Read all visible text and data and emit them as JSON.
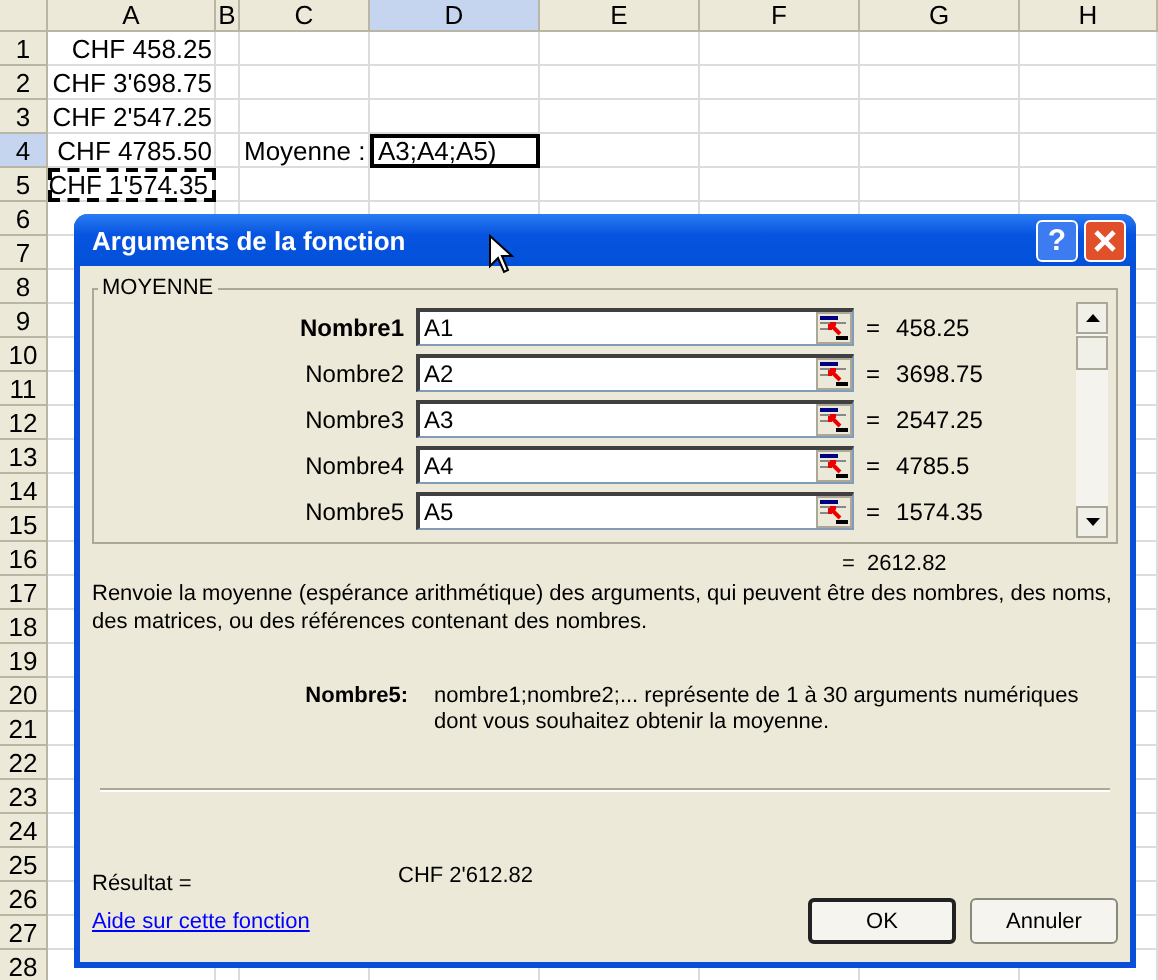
{
  "sheet": {
    "columns": [
      {
        "label": "A",
        "selected": false
      },
      {
        "label": "B",
        "selected": false
      },
      {
        "label": "C",
        "selected": false
      },
      {
        "label": "D",
        "selected": true
      },
      {
        "label": "E",
        "selected": false
      },
      {
        "label": "F",
        "selected": false
      },
      {
        "label": "G",
        "selected": false
      },
      {
        "label": "H",
        "selected": false
      }
    ],
    "rows": [
      {
        "label": "1",
        "selected": false,
        "a": "CHF 458.25"
      },
      {
        "label": "2",
        "selected": false,
        "a": "CHF 3'698.75"
      },
      {
        "label": "3",
        "selected": false,
        "a": "CHF 2'547.25"
      },
      {
        "label": "4",
        "selected": true,
        "a": "CHF 4785.50",
        "c": "Moyenne :",
        "d": "A3;A4;A5)",
        "d_active": true
      },
      {
        "label": "5",
        "selected": false,
        "a": "CHF 1'574.35",
        "a_marquee": true
      },
      {
        "label": "6",
        "selected": false
      },
      {
        "label": "7",
        "selected": false
      },
      {
        "label": "8",
        "selected": false
      },
      {
        "label": "9",
        "selected": false
      },
      {
        "label": "10",
        "selected": false
      },
      {
        "label": "11",
        "selected": false
      },
      {
        "label": "12",
        "selected": false
      },
      {
        "label": "13",
        "selected": false
      },
      {
        "label": "14",
        "selected": false
      },
      {
        "label": "15",
        "selected": false
      },
      {
        "label": "16",
        "selected": false
      },
      {
        "label": "17",
        "selected": false
      },
      {
        "label": "18",
        "selected": false
      },
      {
        "label": "19",
        "selected": false
      },
      {
        "label": "20",
        "selected": false
      },
      {
        "label": "21",
        "selected": false
      },
      {
        "label": "22",
        "selected": false
      },
      {
        "label": "23",
        "selected": false
      },
      {
        "label": "24",
        "selected": false
      },
      {
        "label": "25",
        "selected": false
      },
      {
        "label": "26",
        "selected": false
      },
      {
        "label": "27",
        "selected": false
      },
      {
        "label": "28",
        "selected": false
      }
    ]
  },
  "dialog": {
    "title": "Arguments de la fonction",
    "help_button": "?",
    "function_name": "MOYENNE",
    "arguments": [
      {
        "label": "Nombre1",
        "required": true,
        "value": "A1",
        "equals": "=",
        "result": "458.25"
      },
      {
        "label": "Nombre2",
        "required": false,
        "value": "A2",
        "equals": "=",
        "result": "3698.75"
      },
      {
        "label": "Nombre3",
        "required": false,
        "value": "A3",
        "equals": "=",
        "result": "2547.25"
      },
      {
        "label": "Nombre4",
        "required": false,
        "value": "A4",
        "equals": "=",
        "result": "4785.5"
      },
      {
        "label": "Nombre5",
        "required": false,
        "value": "A5",
        "equals": "=",
        "result": "1574.35"
      }
    ],
    "formula_result": "=  2612.82",
    "description": "Renvoie la moyenne (espérance arithmétique) des arguments, qui peuvent être des nombres, des noms, des matrices, ou des références contenant des nombres.",
    "argument_help": {
      "label": "Nombre5:",
      "text": "nombre1;nombre2;... représente de 1 à 30 arguments numériques dont vous souhaitez obtenir la moyenne."
    },
    "result_label": "Résultat =",
    "result_value": "CHF 2'612.82",
    "help_link": "Aide sur cette fonction",
    "buttons": [
      {
        "label": "OK",
        "default": true
      },
      {
        "label": "Annuler",
        "default": false
      }
    ]
  }
}
